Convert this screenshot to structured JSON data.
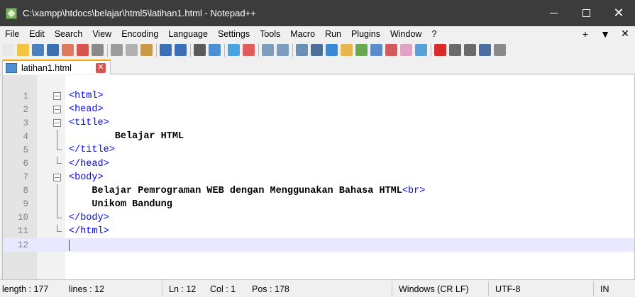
{
  "window": {
    "title": "C:\\xampp\\htdocs\\belajar\\html5\\latihan1.html - Notepad++",
    "app_icon": "notepadpp-icon",
    "minimize": "minimize",
    "maximize": "maximize",
    "close": "✕"
  },
  "menu": {
    "items": [
      "File",
      "Edit",
      "Search",
      "View",
      "Encoding",
      "Language",
      "Settings",
      "Tools",
      "Macro",
      "Run",
      "Plugins",
      "Window",
      "?"
    ],
    "right": [
      "+",
      "▼",
      "✕"
    ]
  },
  "toolbar": {
    "icons": [
      {
        "name": "new-file-icon",
        "color": "#e8e8e8"
      },
      {
        "name": "open-file-icon",
        "color": "#f5c342"
      },
      {
        "name": "save-icon",
        "color": "#4a7fc1"
      },
      {
        "name": "save-all-icon",
        "color": "#3d6fae"
      },
      {
        "name": "close-icon",
        "color": "#e07a5f"
      },
      {
        "name": "close-all-icon",
        "color": "#d9534f"
      },
      {
        "name": "print-icon",
        "color": "#8a8a8a"
      },
      {
        "sep": true
      },
      {
        "name": "cut-icon",
        "color": "#9c9c9c"
      },
      {
        "name": "copy-icon",
        "color": "#b0b0b0"
      },
      {
        "name": "paste-icon",
        "color": "#c79a4a"
      },
      {
        "sep": true
      },
      {
        "name": "undo-icon",
        "color": "#3b6fb6"
      },
      {
        "name": "redo-icon",
        "color": "#3b6fb6"
      },
      {
        "sep": true
      },
      {
        "name": "find-icon",
        "color": "#5a5a5a"
      },
      {
        "name": "replace-icon",
        "color": "#4d8fd1"
      },
      {
        "sep": true
      },
      {
        "name": "zoom-in-icon",
        "color": "#4aa3df"
      },
      {
        "name": "zoom-out-icon",
        "color": "#e05d5d"
      },
      {
        "sep": true
      },
      {
        "name": "sync-vertical-icon",
        "color": "#7d9dbf"
      },
      {
        "name": "sync-horizontal-icon",
        "color": "#7d9dbf"
      },
      {
        "sep": true
      },
      {
        "name": "word-wrap-icon",
        "color": "#6a8fb5"
      },
      {
        "name": "show-all-characters-icon",
        "color": "#4b6f95"
      },
      {
        "name": "indent-guide-icon",
        "color": "#3b8ad9"
      },
      {
        "name": "language-define-icon",
        "color": "#e8b64a"
      },
      {
        "name": "document-map-icon",
        "color": "#6aa84f"
      },
      {
        "name": "function-list-icon",
        "color": "#5b8bc9"
      },
      {
        "name": "folder-workspace-icon",
        "color": "#d45b5b"
      },
      {
        "name": "monitoring-icon",
        "color": "#e0a3c6"
      },
      {
        "name": "eye-icon",
        "color": "#5aa0d8"
      },
      {
        "sep": true
      },
      {
        "name": "record-macro-icon",
        "color": "#d92b2b"
      },
      {
        "name": "stop-record-icon",
        "color": "#6a6a6a"
      },
      {
        "name": "playback-macro-icon",
        "color": "#6a6a6a"
      },
      {
        "name": "run-macro-multiple-icon",
        "color": "#4d6fa0"
      },
      {
        "name": "save-macro-icon",
        "color": "#8a8a8a"
      }
    ]
  },
  "tab": {
    "label": "latihan1.html",
    "close": "✕"
  },
  "editor": {
    "lines": [
      {
        "n": "1",
        "fold": "box",
        "parts": [
          {
            "t": "tag",
            "v": "<html>"
          }
        ]
      },
      {
        "n": "2",
        "fold": "box",
        "parts": [
          {
            "t": "tag",
            "v": "<head>"
          }
        ]
      },
      {
        "n": "3",
        "fold": "box",
        "parts": [
          {
            "t": "tag",
            "v": "<title>"
          }
        ]
      },
      {
        "n": "4",
        "fold": "vline",
        "parts": [
          {
            "t": "txt",
            "v": "        Belajar HTML"
          }
        ]
      },
      {
        "n": "5",
        "fold": "end",
        "parts": [
          {
            "t": "tag",
            "v": "</title>"
          }
        ]
      },
      {
        "n": "6",
        "fold": "end",
        "parts": [
          {
            "t": "tag",
            "v": "</head>"
          }
        ]
      },
      {
        "n": "7",
        "fold": "box",
        "parts": [
          {
            "t": "tag",
            "v": "<body>"
          }
        ]
      },
      {
        "n": "8",
        "fold": "vline",
        "parts": [
          {
            "t": "txt",
            "v": "    Belajar Pemrograman WEB dengan Menggunakan Bahasa HTML"
          },
          {
            "t": "tag",
            "v": "<br>"
          }
        ]
      },
      {
        "n": "9",
        "fold": "vline",
        "parts": [
          {
            "t": "txt",
            "v": "    Unikom Bandung"
          }
        ]
      },
      {
        "n": "10",
        "fold": "end",
        "parts": [
          {
            "t": "tag",
            "v": "</body>"
          }
        ]
      },
      {
        "n": "11",
        "fold": "end",
        "parts": [
          {
            "t": "tag",
            "v": "</html>"
          }
        ]
      },
      {
        "n": "12",
        "fold": "",
        "parts": [],
        "current": true
      }
    ]
  },
  "status": {
    "length": "length : 177",
    "lines": "lines : 12",
    "ln": "Ln : 12",
    "col": "Col : 1",
    "pos": "Pos : 178",
    "eol": "Windows (CR LF)",
    "encoding": "UTF-8",
    "mode": "IN"
  }
}
